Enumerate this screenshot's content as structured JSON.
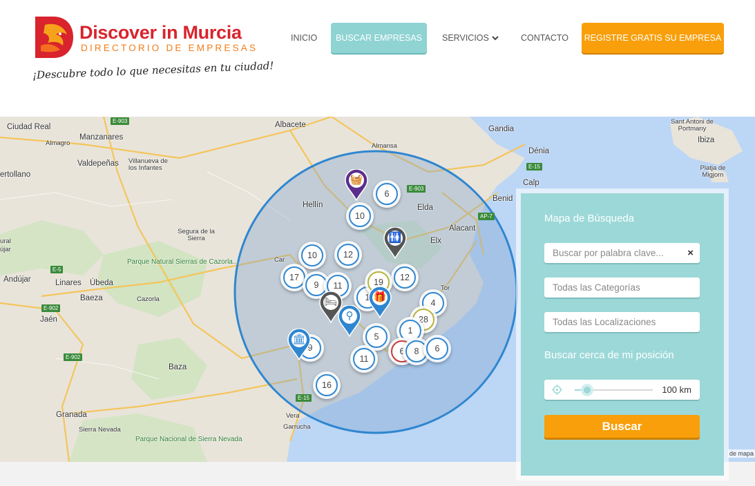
{
  "brand": {
    "title": "Discover in Murcia",
    "subtitle": "DIRECTORIO DE EMPRESAS",
    "tagline": "¡Descubre todo lo que necesitas en tu ciudad!",
    "colors": {
      "red": "#d9232d",
      "orange": "#ef7d1a"
    }
  },
  "nav": {
    "items": [
      {
        "label": "INICIO"
      },
      {
        "label": "BUSCAR EMPRESAS",
        "active": true
      },
      {
        "label": "SERVICIOS",
        "has_dropdown": true
      },
      {
        "label": "CONTACTO"
      },
      {
        "label": "REGISTRE GRATIS SU EMPRESA",
        "highlight": true
      }
    ],
    "colors": {
      "active": "#8fd3d3",
      "cta": "#f99f0b"
    }
  },
  "map": {
    "place_labels": [
      "Ciudad Real",
      "Almagro",
      "Manzanares",
      "Valdepeñas",
      "Villanueva de los Infantes",
      "ertollano",
      "Albacete",
      "Almansa",
      "Hellín",
      "Elda",
      "Alacant",
      "Elx",
      "Benid",
      "Gandia",
      "Dénia",
      "Calp",
      "Ibiza",
      "Sant Antoni de Portmany",
      "Platja de Migjorn",
      "Segura de la Sierra",
      "Linares",
      "Úbeda",
      "Andújar",
      "Baeza",
      "Cazorla",
      "Jaén",
      "Baza",
      "Granada",
      "Sierra Nevada",
      "Garrucha",
      "Car",
      "Tor",
      "Vera",
      "ural",
      "újar"
    ],
    "park_labels": [
      "Parque Natural Sierras de Cazorla...",
      "Parque Nacional de Sierra Nevada"
    ],
    "road_labels": [
      "E-903",
      "E-5",
      "E-902",
      "E-902",
      "E-15",
      "E-15",
      "E-903",
      "AP-7"
    ],
    "clusters": [
      {
        "count": "6"
      },
      {
        "count": "10"
      },
      {
        "count": "12"
      },
      {
        "count": "10"
      },
      {
        "count": "17"
      },
      {
        "count": "9"
      },
      {
        "count": "11"
      },
      {
        "count": "12"
      },
      {
        "count": "4"
      },
      {
        "count": "28",
        "style": "olive"
      },
      {
        "count": "1"
      },
      {
        "count": "5"
      },
      {
        "count": "8"
      },
      {
        "count": "6"
      },
      {
        "count": "11"
      },
      {
        "count": "6",
        "style": "red"
      },
      {
        "count": "9"
      },
      {
        "count": "16"
      },
      {
        "count": "1"
      },
      {
        "count": "19",
        "style": "olive"
      }
    ],
    "pins": [
      {
        "icon": "shopping-basket-icon",
        "color": "#5b2e8c"
      },
      {
        "icon": "restroom-icon",
        "color": "#555555"
      },
      {
        "icon": "bed-icon",
        "color": "#555555"
      },
      {
        "icon": "baby-stroller-icon",
        "color": "#2f86d0"
      },
      {
        "icon": "gift-icon",
        "color": "#2f86d0"
      },
      {
        "icon": "museum-icon",
        "color": "#2f86d0"
      }
    ],
    "attribution": "de mapa"
  },
  "search": {
    "title": "Mapa de Búsqueda",
    "keyword_placeholder": "Buscar por palabra clave...",
    "clear_glyph": "×",
    "category_value": "Todas las Categorías",
    "location_value": "Todas las Localizaciones",
    "near_title": "Buscar cerca de mi posición",
    "radius_value": "100",
    "radius_unit": "km",
    "radius_fraction": 0.08,
    "button_label": "Buscar",
    "colors": {
      "panel": "#9cd8d8",
      "button": "#f99f0b"
    }
  }
}
